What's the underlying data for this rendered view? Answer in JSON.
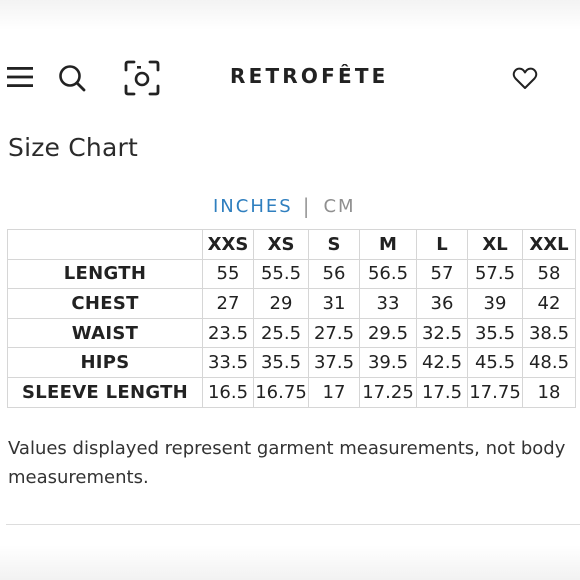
{
  "header": {
    "brand": "RETROFÊTE",
    "icons": [
      "menu-icon",
      "search-icon",
      "camera-icon",
      "heart-icon"
    ]
  },
  "title": "Size Chart",
  "units": {
    "active": "INCHES",
    "separator": "|",
    "inactive": "CM",
    "active_color": "#2f7fbf"
  },
  "table": {
    "headers": [
      "XXS",
      "XS",
      "S",
      "M",
      "L",
      "XL",
      "XXL"
    ],
    "rows": [
      {
        "label": "LENGTH",
        "values": [
          "55",
          "55.5",
          "56",
          "56.5",
          "57",
          "57.5",
          "58"
        ]
      },
      {
        "label": "CHEST",
        "values": [
          "27",
          "29",
          "31",
          "33",
          "36",
          "39",
          "42"
        ]
      },
      {
        "label": "WAIST",
        "values": [
          "23.5",
          "25.5",
          "27.5",
          "29.5",
          "32.5",
          "35.5",
          "38.5"
        ]
      },
      {
        "label": "HIPS",
        "values": [
          "33.5",
          "35.5",
          "37.5",
          "39.5",
          "42.5",
          "45.5",
          "48.5"
        ]
      },
      {
        "label": "SLEEVE LENGTH",
        "values": [
          "16.5",
          "16.75",
          "17",
          "17.25",
          "17.5",
          "17.75",
          "18"
        ]
      }
    ]
  },
  "note": "Values displayed represent garment measurements, not body measurements."
}
